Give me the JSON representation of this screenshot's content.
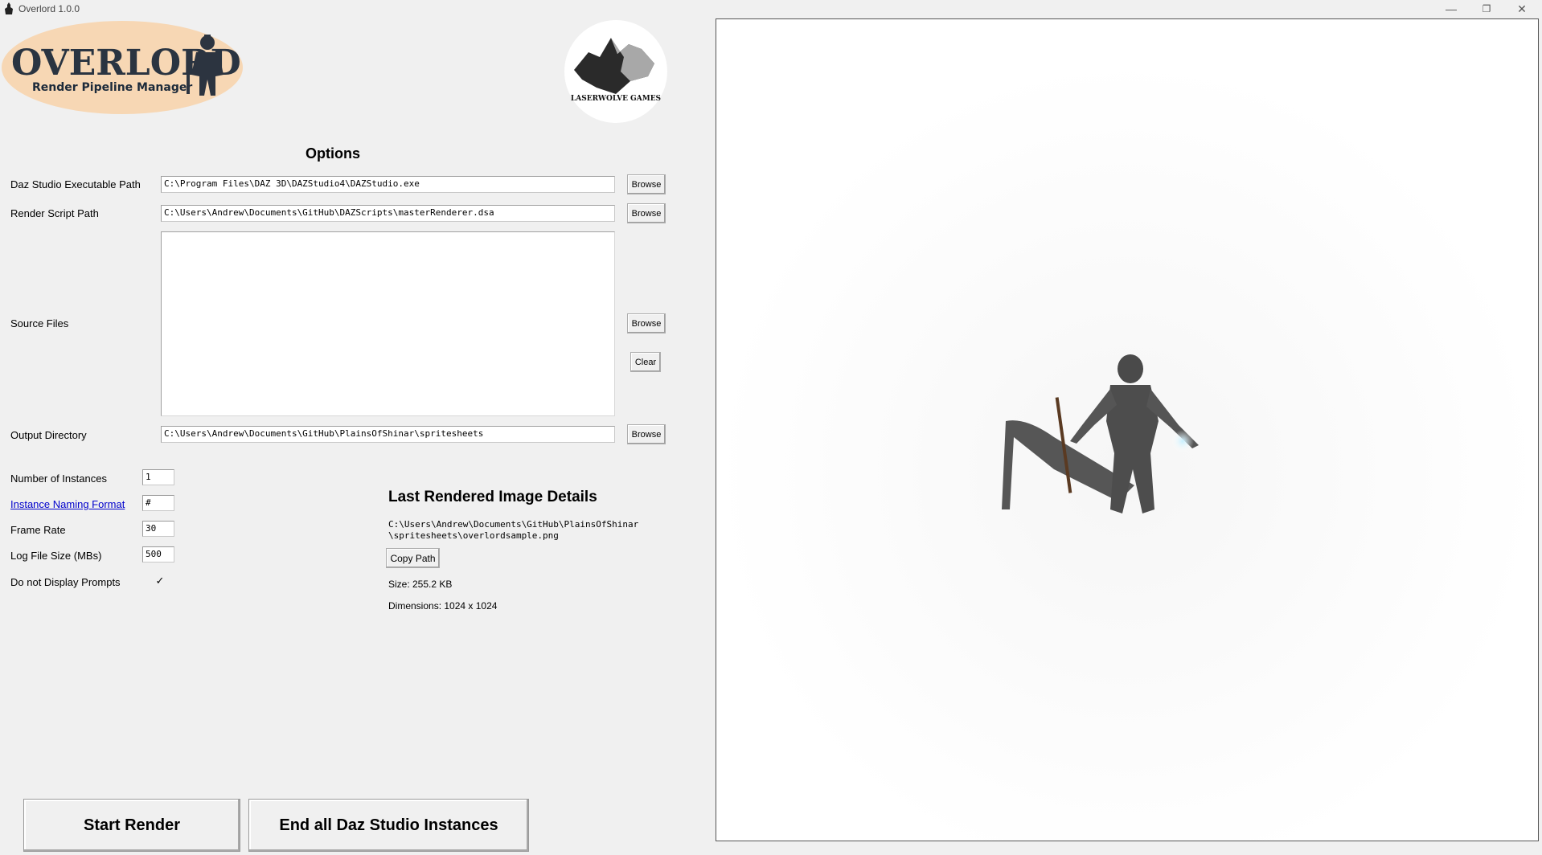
{
  "window": {
    "title": "Overlord 1.0.0",
    "minimize_icon": "minimize-icon",
    "restore_icon": "restore-icon",
    "close_icon": "close-icon"
  },
  "logo": {
    "title": "OVERLORD",
    "subtitle": "Render Pipeline Manager",
    "company": "LASERWOLVE GAMES"
  },
  "options": {
    "heading": "Options",
    "daz_exe": {
      "label": "Daz Studio Executable Path",
      "value": "C:\\Program Files\\DAZ 3D\\DAZStudio4\\DAZStudio.exe",
      "button": "Browse"
    },
    "render_script": {
      "label": "Render Script Path",
      "value": "C:\\Users\\Andrew\\Documents\\GitHub\\DAZScripts\\masterRenderer.dsa",
      "button": "Browse"
    },
    "source_files": {
      "label": "Source Files",
      "browse": "Browse",
      "clear": "Clear"
    },
    "output_dir": {
      "label": "Output Directory",
      "value": "C:\\Users\\Andrew\\Documents\\GitHub\\PlainsOfShinar\\spritesheets",
      "button": "Browse"
    },
    "instances": {
      "label": "Number of Instances",
      "value": "1"
    },
    "naming": {
      "label": "Instance Naming Format",
      "value": "#"
    },
    "frame_rate": {
      "label": "Frame Rate",
      "value": "30"
    },
    "log_size": {
      "label": "Log File Size (MBs)",
      "value": "500"
    },
    "no_prompts": {
      "label": "Do not Display Prompts",
      "checked": true
    }
  },
  "last_render": {
    "heading": "Last Rendered Image Details",
    "path_line1": "C:\\Users\\Andrew\\Documents\\GitHub\\PlainsOfShinar",
    "path_line2": "\\spritesheets\\overlordsample.png",
    "copy_button": "Copy Path",
    "size": "Size: 255.2 KB",
    "dimensions": "Dimensions: 1024 x 1024"
  },
  "actions": {
    "start": "Start Render",
    "end_all": "End all Daz Studio Instances"
  }
}
